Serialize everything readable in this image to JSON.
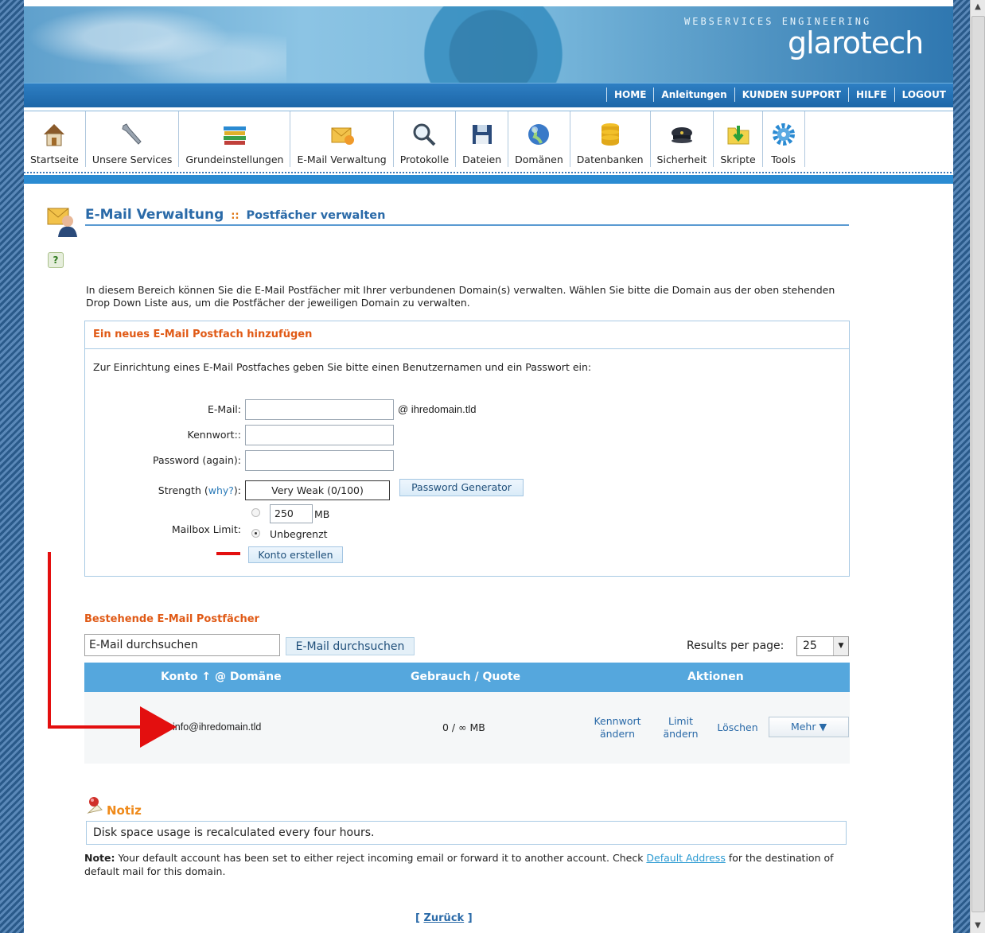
{
  "banner": {
    "tagline": "WEBSERVICES  ENGINEERING",
    "logo": "glarotech"
  },
  "topnav": [
    "HOME",
    "Anleitungen",
    "KUNDEN SUPPORT",
    "HILFE",
    "LOGOUT"
  ],
  "toolbar": [
    {
      "label": "Startseite",
      "icon": "home-icon"
    },
    {
      "label": "Unsere Services",
      "icon": "wrench-icon"
    },
    {
      "label": "Grundeinstellungen",
      "icon": "books-icon"
    },
    {
      "label": "E-Mail Verwaltung",
      "icon": "mail-icon"
    },
    {
      "label": "Protokolle",
      "icon": "magnifier-icon"
    },
    {
      "label": "Dateien",
      "icon": "floppy-icon"
    },
    {
      "label": "Domänen",
      "icon": "globe-icon"
    },
    {
      "label": "Datenbanken",
      "icon": "database-icon"
    },
    {
      "label": "Sicherheit",
      "icon": "police-cap-icon"
    },
    {
      "label": "Skripte",
      "icon": "folder-arrow-icon"
    },
    {
      "label": "Tools",
      "icon": "gear-icon"
    }
  ],
  "page": {
    "title": "E-Mail Verwaltung",
    "separator": "::",
    "subtitle": "Postfächer verwalten",
    "help": "?",
    "intro": "In diesem Bereich können Sie die E-Mail Postfächer mit Ihrer verbundenen Domain(s) verwalten. Wählen Sie bitte die Domain aus der oben stehenden Drop Down Liste aus, um die Postfächer der jeweiligen Domain zu verwalten."
  },
  "new_box": {
    "title": "Ein neues E-Mail Postfach hinzufügen",
    "instructions": "Zur Einrichtung eines E-Mail Postfaches geben Sie bitte einen Benutzernamen und ein Passwort ein:",
    "email_label": "E-Mail:",
    "domain_suffix": "@ ihredomain.tld",
    "password_label": "Kennwort::",
    "password_again_label": "Password (again):",
    "strength_label": "Strength (",
    "strength_link": "why?",
    "strength_label_end": "):",
    "strength_value": "Very Weak (0/100)",
    "generator_button": "Password Generator",
    "limit_label": "Mailbox Limit:",
    "limit_value": "250",
    "limit_unit": "MB",
    "unlimited_label": "Unbegrenzt",
    "create_button": "Konto erstellen"
  },
  "existing": {
    "title": "Bestehende E-Mail Postfächer",
    "search_value": "E-Mail durchsuchen",
    "search_button": "E-Mail durchsuchen",
    "rpp_label": "Results per page:",
    "rpp_value": "25",
    "columns": [
      "Konto ↑ @ Domäne",
      "Gebrauch / Quote",
      "Aktionen"
    ],
    "rows": [
      {
        "account": "info@ihredomain.tld",
        "usage": "0 / ∞ MB",
        "actions": [
          "Kennwort ändern",
          "Limit ändern",
          "Löschen",
          "Mehr ▼"
        ]
      }
    ]
  },
  "note": {
    "title": "Notiz",
    "text": "Disk space usage is recalculated every four hours.",
    "footnote_bold": "Note:",
    "footnote_text": " Your default account has been set to either reject incoming email or forward it to another account. Check ",
    "footnote_link": "Default Address",
    "footnote_end": " for the destination of default mail for this domain."
  },
  "back": {
    "open": "[ ",
    "label": "Zurück",
    "close": " ]"
  },
  "colors": {
    "accent": "#2a8bd2",
    "section_title": "#e05a16",
    "annotation": "#e30f0f"
  }
}
